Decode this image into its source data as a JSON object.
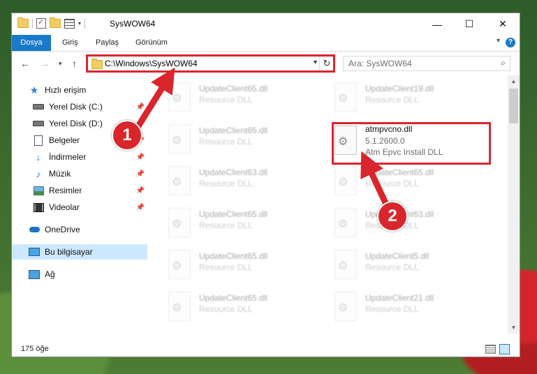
{
  "window": {
    "title": "SysWOW64",
    "minimize_glyph": "—",
    "maximize_glyph": "☐",
    "close_glyph": "✕"
  },
  "ribbon": {
    "tabs": [
      "Dosya",
      "Giriş",
      "Paylaş",
      "Görünüm"
    ],
    "help_glyph": "?"
  },
  "nav": {
    "address": "C:\\Windows\\SysWOW64",
    "search_placeholder": "Ara: SysWOW64"
  },
  "sidebar": {
    "items": [
      {
        "label": "Hızlı erişim",
        "icon": "star-icon"
      },
      {
        "label": "Yerel Disk (C:)",
        "icon": "drive-icon",
        "pinned": true
      },
      {
        "label": "Yerel Disk (D:)",
        "icon": "drive-icon",
        "pinned": true
      },
      {
        "label": "Belgeler",
        "icon": "documents-icon",
        "pinned": true
      },
      {
        "label": "İndirmeler",
        "icon": "downloads-icon",
        "pinned": true
      },
      {
        "label": "Müzik",
        "icon": "music-icon",
        "pinned": true
      },
      {
        "label": "Resimler",
        "icon": "pictures-icon",
        "pinned": true
      },
      {
        "label": "Videolar",
        "icon": "videos-icon",
        "pinned": true
      },
      {
        "label": "OneDrive",
        "icon": "cloud-icon"
      },
      {
        "label": "Bu bilgisayar",
        "icon": "computer-icon",
        "selected": true
      },
      {
        "label": "Ağ",
        "icon": "network-icon"
      }
    ]
  },
  "files": {
    "left": [
      {
        "name": "UpdateClient65.dll",
        "desc": "Resource DLL"
      },
      {
        "name": "UpdateClient65.dll",
        "desc": "Resource DLL"
      },
      {
        "name": "UpdateClient63.dll",
        "desc": "Resource DLL"
      },
      {
        "name": "UpdateClient65.dll",
        "desc": "Resource DLL"
      },
      {
        "name": "UpdateClient65.dll",
        "desc": "Resource DLL"
      },
      {
        "name": "UpdateClient65.dll",
        "desc": "Resource DLL"
      }
    ],
    "right": [
      {
        "name": "UpdateClient19.dll",
        "desc": "Resource DLL"
      },
      {
        "name": "UpdateClient65.dll",
        "desc": "Resource DLL"
      },
      {
        "name": "UpdateClient63.dll",
        "desc": "Resource DLL"
      },
      {
        "name": "UpdateClient5.dll",
        "desc": "Resource DLL"
      },
      {
        "name": "UpdateClient21.dll",
        "desc": "Resource DLL"
      }
    ],
    "highlighted": {
      "name": "atmpvcno.dll",
      "version": "5.1.2600.0",
      "desc": "Atm Epvc Install DLL"
    }
  },
  "status": {
    "count": "175 öğe"
  },
  "annotations": {
    "badge1": "1",
    "badge2": "2",
    "accent": "#d9262c"
  }
}
